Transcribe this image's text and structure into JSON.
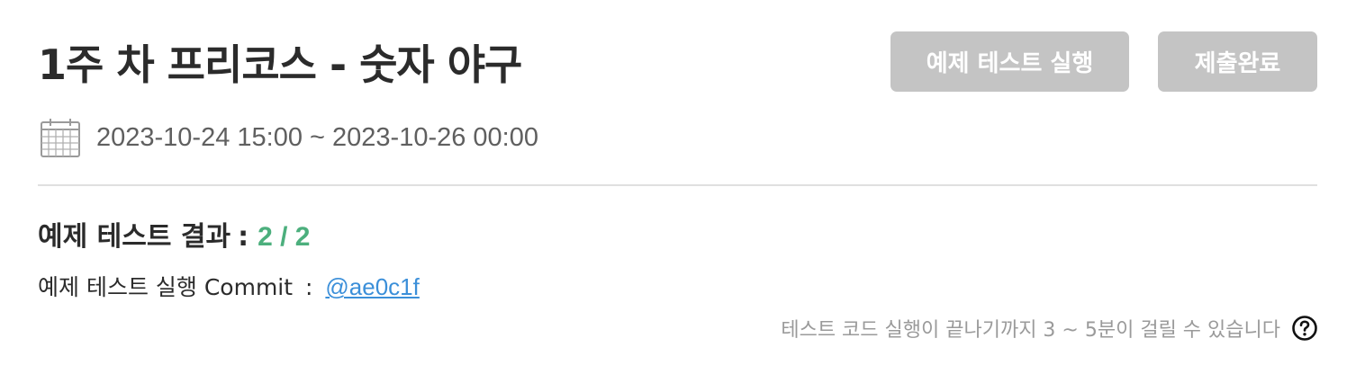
{
  "header": {
    "title": "1주 차 프리코스 - 숫자 야구",
    "run_button_label": "예제 테스트 실행",
    "submit_button_label": "제출완료"
  },
  "schedule": {
    "icon": "calendar-icon",
    "period": "2023-10-24 15:00 ~ 2023-10-26 00:00"
  },
  "result": {
    "label": "예제 테스트 결과",
    "separator": ":",
    "score": "2 / 2",
    "score_color": "#4caf7d"
  },
  "commit": {
    "label": "예제 테스트 실행 Commit",
    "separator": ":",
    "hash": "@ae0c1f",
    "link_color": "#3b8fd9"
  },
  "notice": {
    "text": "테스트 코드 실행이 끝나기까지 3 ~ 5분이 걸릴 수 있습니다",
    "icon": "help-icon"
  },
  "colors": {
    "button_bg": "#c4c4c4",
    "divider": "#e0e0e0"
  }
}
